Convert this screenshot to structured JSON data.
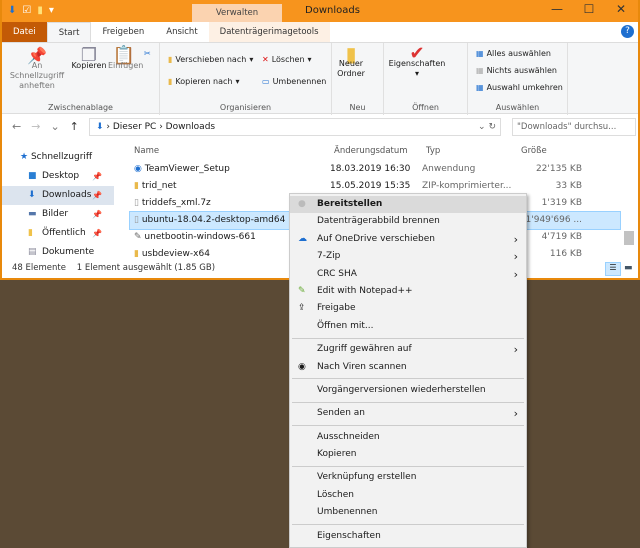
{
  "titlebar": {
    "context_tab": "Verwalten",
    "title": "Downloads",
    "minimize": "—",
    "maximize": "☐",
    "close": "✕"
  },
  "tabs": [
    "Datei",
    "Start",
    "Freigeben",
    "Ansicht",
    "Datenträgerimagetools"
  ],
  "ribbon": {
    "clipboard": {
      "pin": "An Schnellzugriff anheften",
      "copy": "Kopieren",
      "paste": "Einfügen",
      "label": "Zwischenablage"
    },
    "organize": {
      "move": "Verschieben nach",
      "copyto": "Kopieren nach",
      "delete": "Löschen",
      "rename": "Umbenennen",
      "label": "Organisieren"
    },
    "new": {
      "folder": "Neuer Ordner",
      "label": "Neu"
    },
    "open": {
      "properties": "Eigenschaften",
      "label": "Öffnen"
    },
    "select": {
      "all": "Alles auswählen",
      "none": "Nichts auswählen",
      "invert": "Auswahl umkehren",
      "label": "Auswählen"
    }
  },
  "address": {
    "crumbs": [
      "Dieser PC",
      "Downloads"
    ],
    "search_placeholder": "\"Downloads\" durchsu..."
  },
  "sidebar": [
    {
      "label": "Schnellzugriff"
    },
    {
      "label": "Desktop"
    },
    {
      "label": "Downloads"
    },
    {
      "label": "Bilder"
    },
    {
      "label": "Öffentlich"
    },
    {
      "label": "Dokumente"
    }
  ],
  "columns": [
    "Name",
    "Änderungsdatum",
    "Typ",
    "Größe"
  ],
  "files": [
    {
      "name": "TeamViewer_Setup",
      "date": "18.03.2019 16:30",
      "type": "Anwendung",
      "size": "22'135 KB"
    },
    {
      "name": "trid_net",
      "date": "15.05.2019 15:35",
      "type": "ZIP-komprimierter...",
      "size": "33 KB"
    },
    {
      "name": "triddefs_xml.7z",
      "date": "",
      "type": "",
      "size": "1'319 KB"
    },
    {
      "name": "ubuntu-18.04.2-desktop-amd64",
      "date": "",
      "type": "",
      "size": "1'949'696 ..."
    },
    {
      "name": "unetbootin-windows-661",
      "date": "",
      "type": "",
      "size": "4'719 KB"
    },
    {
      "name": "usbdeview-x64",
      "date": "",
      "type": "",
      "size": "116 KB"
    }
  ],
  "status": {
    "count": "48 Elemente",
    "selected": "1 Element ausgewählt (1.85 GB)"
  },
  "menu": {
    "mount": "Bereitstellen",
    "burn": "Datenträgerabbild brennen",
    "onedrive": "Auf OneDrive verschieben",
    "zip": "7-Zip",
    "crc": "CRC SHA",
    "notepad": "Edit with Notepad++",
    "share": "Freigabe",
    "openwith": "Öffnen mit...",
    "access": "Zugriff gewähren auf",
    "scan": "Nach Viren scannen",
    "restore": "Vorgängerversionen wiederherstellen",
    "sendto": "Senden an",
    "cut": "Ausschneiden",
    "copy": "Kopieren",
    "shortcut": "Verknüpfung erstellen",
    "delete": "Löschen",
    "rename": "Umbenennen",
    "properties": "Eigenschaften"
  }
}
